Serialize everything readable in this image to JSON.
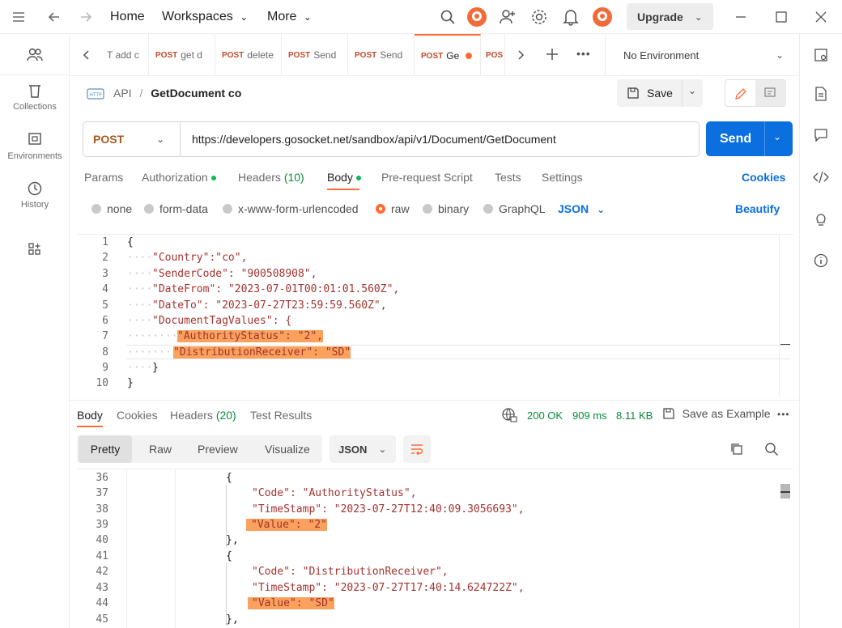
{
  "topbar": {
    "home": "Home",
    "workspaces": "Workspaces",
    "more": "More",
    "upgrade": "Upgrade"
  },
  "sidebar": {
    "items": [
      {
        "label": "",
        "icon": "people-icon"
      },
      {
        "label": "Collections",
        "icon": "trash-can-icon"
      },
      {
        "label": "Environments",
        "icon": "environment-icon"
      },
      {
        "label": "History",
        "icon": "history-icon"
      },
      {
        "label": "",
        "icon": "apps-add-icon"
      }
    ]
  },
  "tabs": [
    {
      "method": "",
      "name": "T add c"
    },
    {
      "method": "POST",
      "name": "get d"
    },
    {
      "method": "POST",
      "name": "delete"
    },
    {
      "method": "POST",
      "name": "Send"
    },
    {
      "method": "POST",
      "name": "Send"
    },
    {
      "method": "POST",
      "name": "Ge"
    },
    {
      "method": "POS",
      "name": ""
    }
  ],
  "environment": "No Environment",
  "breadcrumb": {
    "parent": "API",
    "current": "GetDocument co"
  },
  "save_label": "Save",
  "request": {
    "method": "POST",
    "url": "https://developers.gosocket.net/sandbox/api/v1/Document/GetDocument",
    "send_label": "Send"
  },
  "request_tabs": {
    "params": "Params",
    "authorization": "Authorization",
    "headers": "Headers",
    "headers_count": "(10)",
    "body": "Body",
    "prerequest": "Pre-request Script",
    "tests": "Tests",
    "settings": "Settings",
    "cookies": "Cookies"
  },
  "body_options": {
    "none": "none",
    "form_data": "form-data",
    "urlencoded": "x-www-form-urlencoded",
    "raw": "raw",
    "binary": "binary",
    "graphql": "GraphQL",
    "format": "JSON",
    "beautify": "Beautify"
  },
  "request_body_lines": [
    {
      "n": "1",
      "text": "{"
    },
    {
      "n": "2",
      "text": "\"Country\":\"co\","
    },
    {
      "n": "3",
      "text": "\"SenderCode\": \"900508908\","
    },
    {
      "n": "4",
      "text": "\"DateFrom\": \"2023-07-01T00:01:01.560Z\","
    },
    {
      "n": "5",
      "text": "\"DateTo\": \"2023-07-27T23:59:59.560Z\","
    },
    {
      "n": "6",
      "text": "\"DocumentTagValues\": {"
    },
    {
      "n": "7",
      "text": "\"AuthorityStatus\": \"2\","
    },
    {
      "n": "8",
      "text": "\"DistributionReceiver\": \"SD\""
    },
    {
      "n": "9",
      "text": "}"
    },
    {
      "n": "10",
      "text": "}"
    }
  ],
  "response": {
    "tabs": {
      "body": "Body",
      "cookies": "Cookies",
      "headers": "Headers",
      "headers_count": "(20)",
      "tests": "Test Results"
    },
    "status": "200 OK",
    "time": "909 ms",
    "size": "8.11 KB",
    "save_example": "Save as Example",
    "views": {
      "pretty": "Pretty",
      "raw": "Raw",
      "preview": "Preview",
      "visualize": "Visualize",
      "format": "JSON"
    },
    "lines": [
      {
        "n": "36",
        "text": "{"
      },
      {
        "n": "37",
        "text": "\"Code\": \"AuthorityStatus\","
      },
      {
        "n": "38",
        "text": "\"TimeStamp\": \"2023-07-27T12:40:09.3056693\","
      },
      {
        "n": "39",
        "text": "\"Value\": \"2\""
      },
      {
        "n": "40",
        "text": "},"
      },
      {
        "n": "41",
        "text": "{"
      },
      {
        "n": "42",
        "text": "\"Code\": \"DistributionReceiver\","
      },
      {
        "n": "43",
        "text": "\"TimeStamp\": \"2023-07-27T17:40:14.624722Z\","
      },
      {
        "n": "44",
        "text": "\"Value\": \"SD\""
      },
      {
        "n": "45",
        "text": "},"
      }
    ]
  },
  "colors": {
    "accent": "#ff6c37",
    "send": "#0b6fe0",
    "highlight": "#f9a15d",
    "status_ok": "#0a8a3a"
  }
}
